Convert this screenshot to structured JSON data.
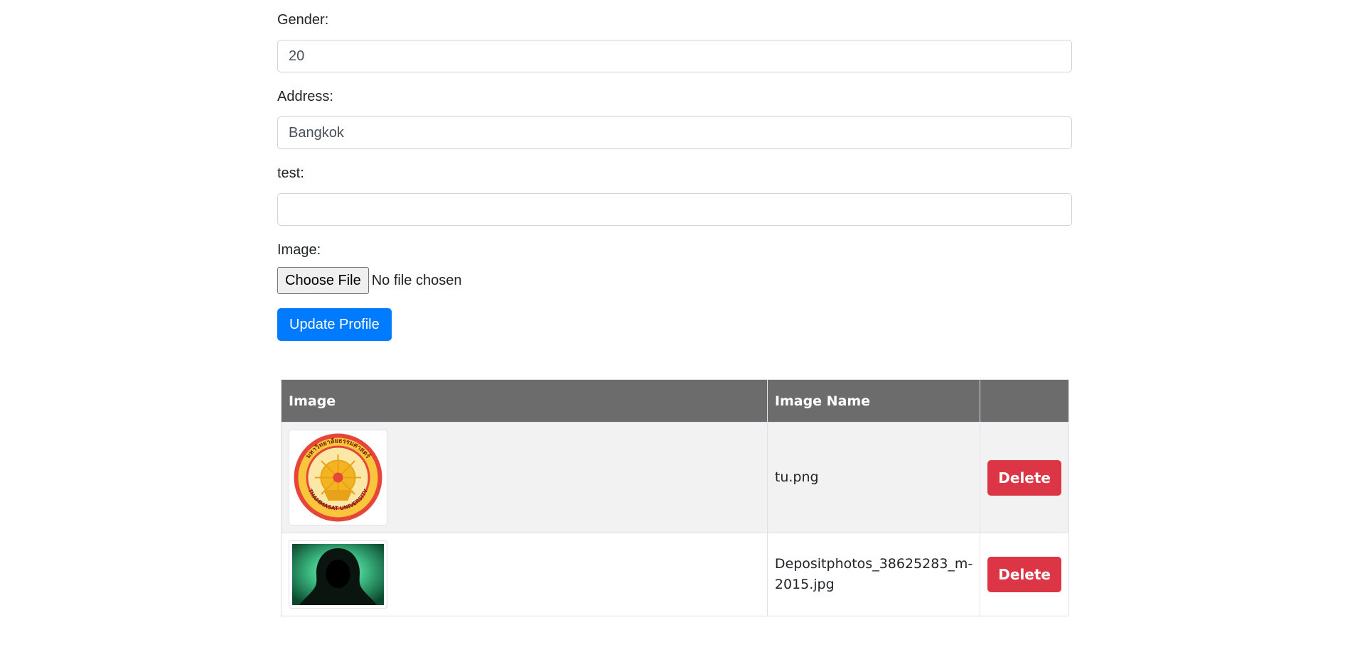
{
  "form": {
    "gender": {
      "label": "Gender:",
      "value": "20"
    },
    "address": {
      "label": "Address:",
      "value": "Bangkok"
    },
    "test": {
      "label": "test:",
      "value": ""
    },
    "image": {
      "label": "Image:",
      "choose_label": "Choose File",
      "status": "No file chosen"
    },
    "submit_label": "Update Profile"
  },
  "table": {
    "headers": [
      "Image",
      "Image Name",
      ""
    ],
    "rows": [
      {
        "name": "tu.png",
        "delete_label": "Delete"
      },
      {
        "name": "Depositphotos_38625283_m-2015.jpg",
        "delete_label": "Delete"
      }
    ]
  },
  "logo_text": {
    "top": "มหาวิทยาลัยธรรมศาสตร์",
    "bottom": "THAMMASAT UNIVERSITY"
  },
  "colors": {
    "primary": "#007bff",
    "danger": "#dc3545",
    "table_header": "#6c6c6c"
  }
}
